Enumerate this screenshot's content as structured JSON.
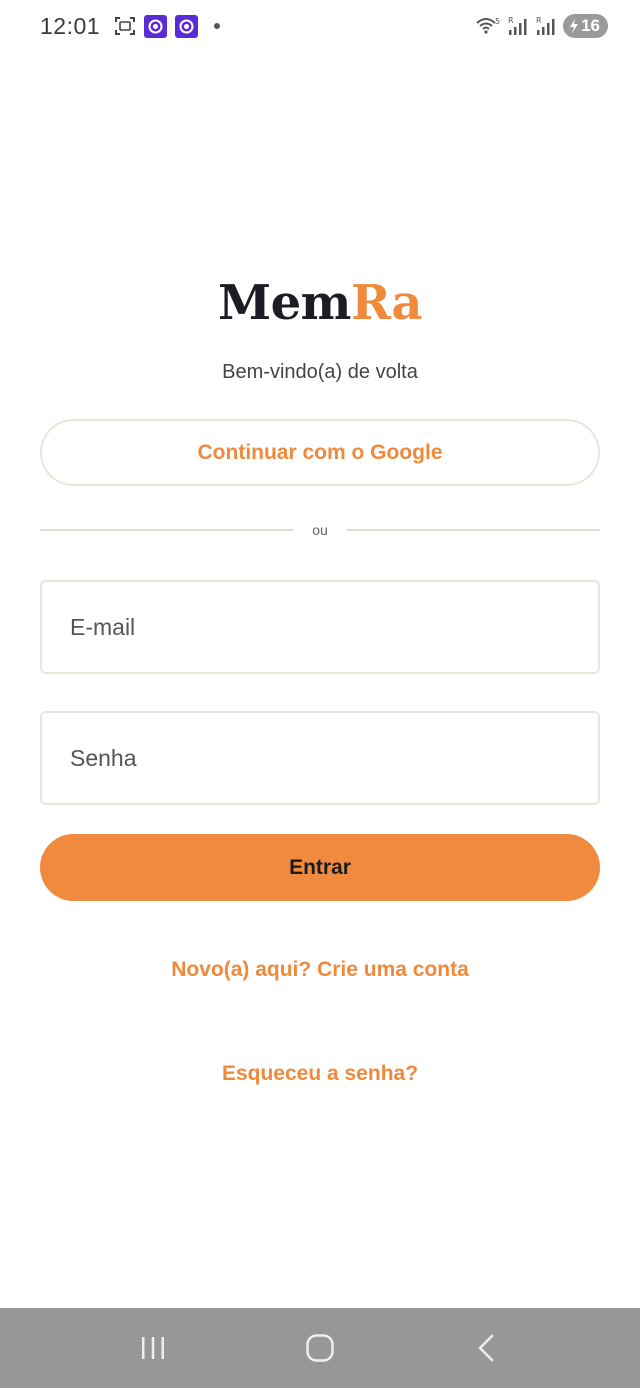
{
  "status_bar": {
    "time": "12:01",
    "battery": "16",
    "icons": [
      "screenshot-icon",
      "app-notification-icon",
      "app-notification-icon",
      "notification-dot-icon",
      "wifi-icon",
      "signal-icon",
      "signal-icon",
      "battery-icon"
    ]
  },
  "logo": {
    "part1": "Mem",
    "part2": "Ra"
  },
  "welcome": "Bem-vindo(a) de volta",
  "google_button": "Continuar com o Google",
  "divider_text": "ou",
  "email_field": {
    "placeholder": "E-mail",
    "value": ""
  },
  "password_field": {
    "placeholder": "Senha",
    "value": ""
  },
  "login_button": "Entrar",
  "signup_link": "Novo(a) aqui? Crie uma conta",
  "forgot_link": "Esqueceu a senha?",
  "nav_bar": {
    "icons": [
      "recent-apps-icon",
      "home-icon",
      "back-icon"
    ]
  },
  "colors": {
    "accent": "#ef8a3c",
    "logo_dark": "#1c1c24",
    "border": "#ebe6dc",
    "nav_bg": "#979797"
  }
}
